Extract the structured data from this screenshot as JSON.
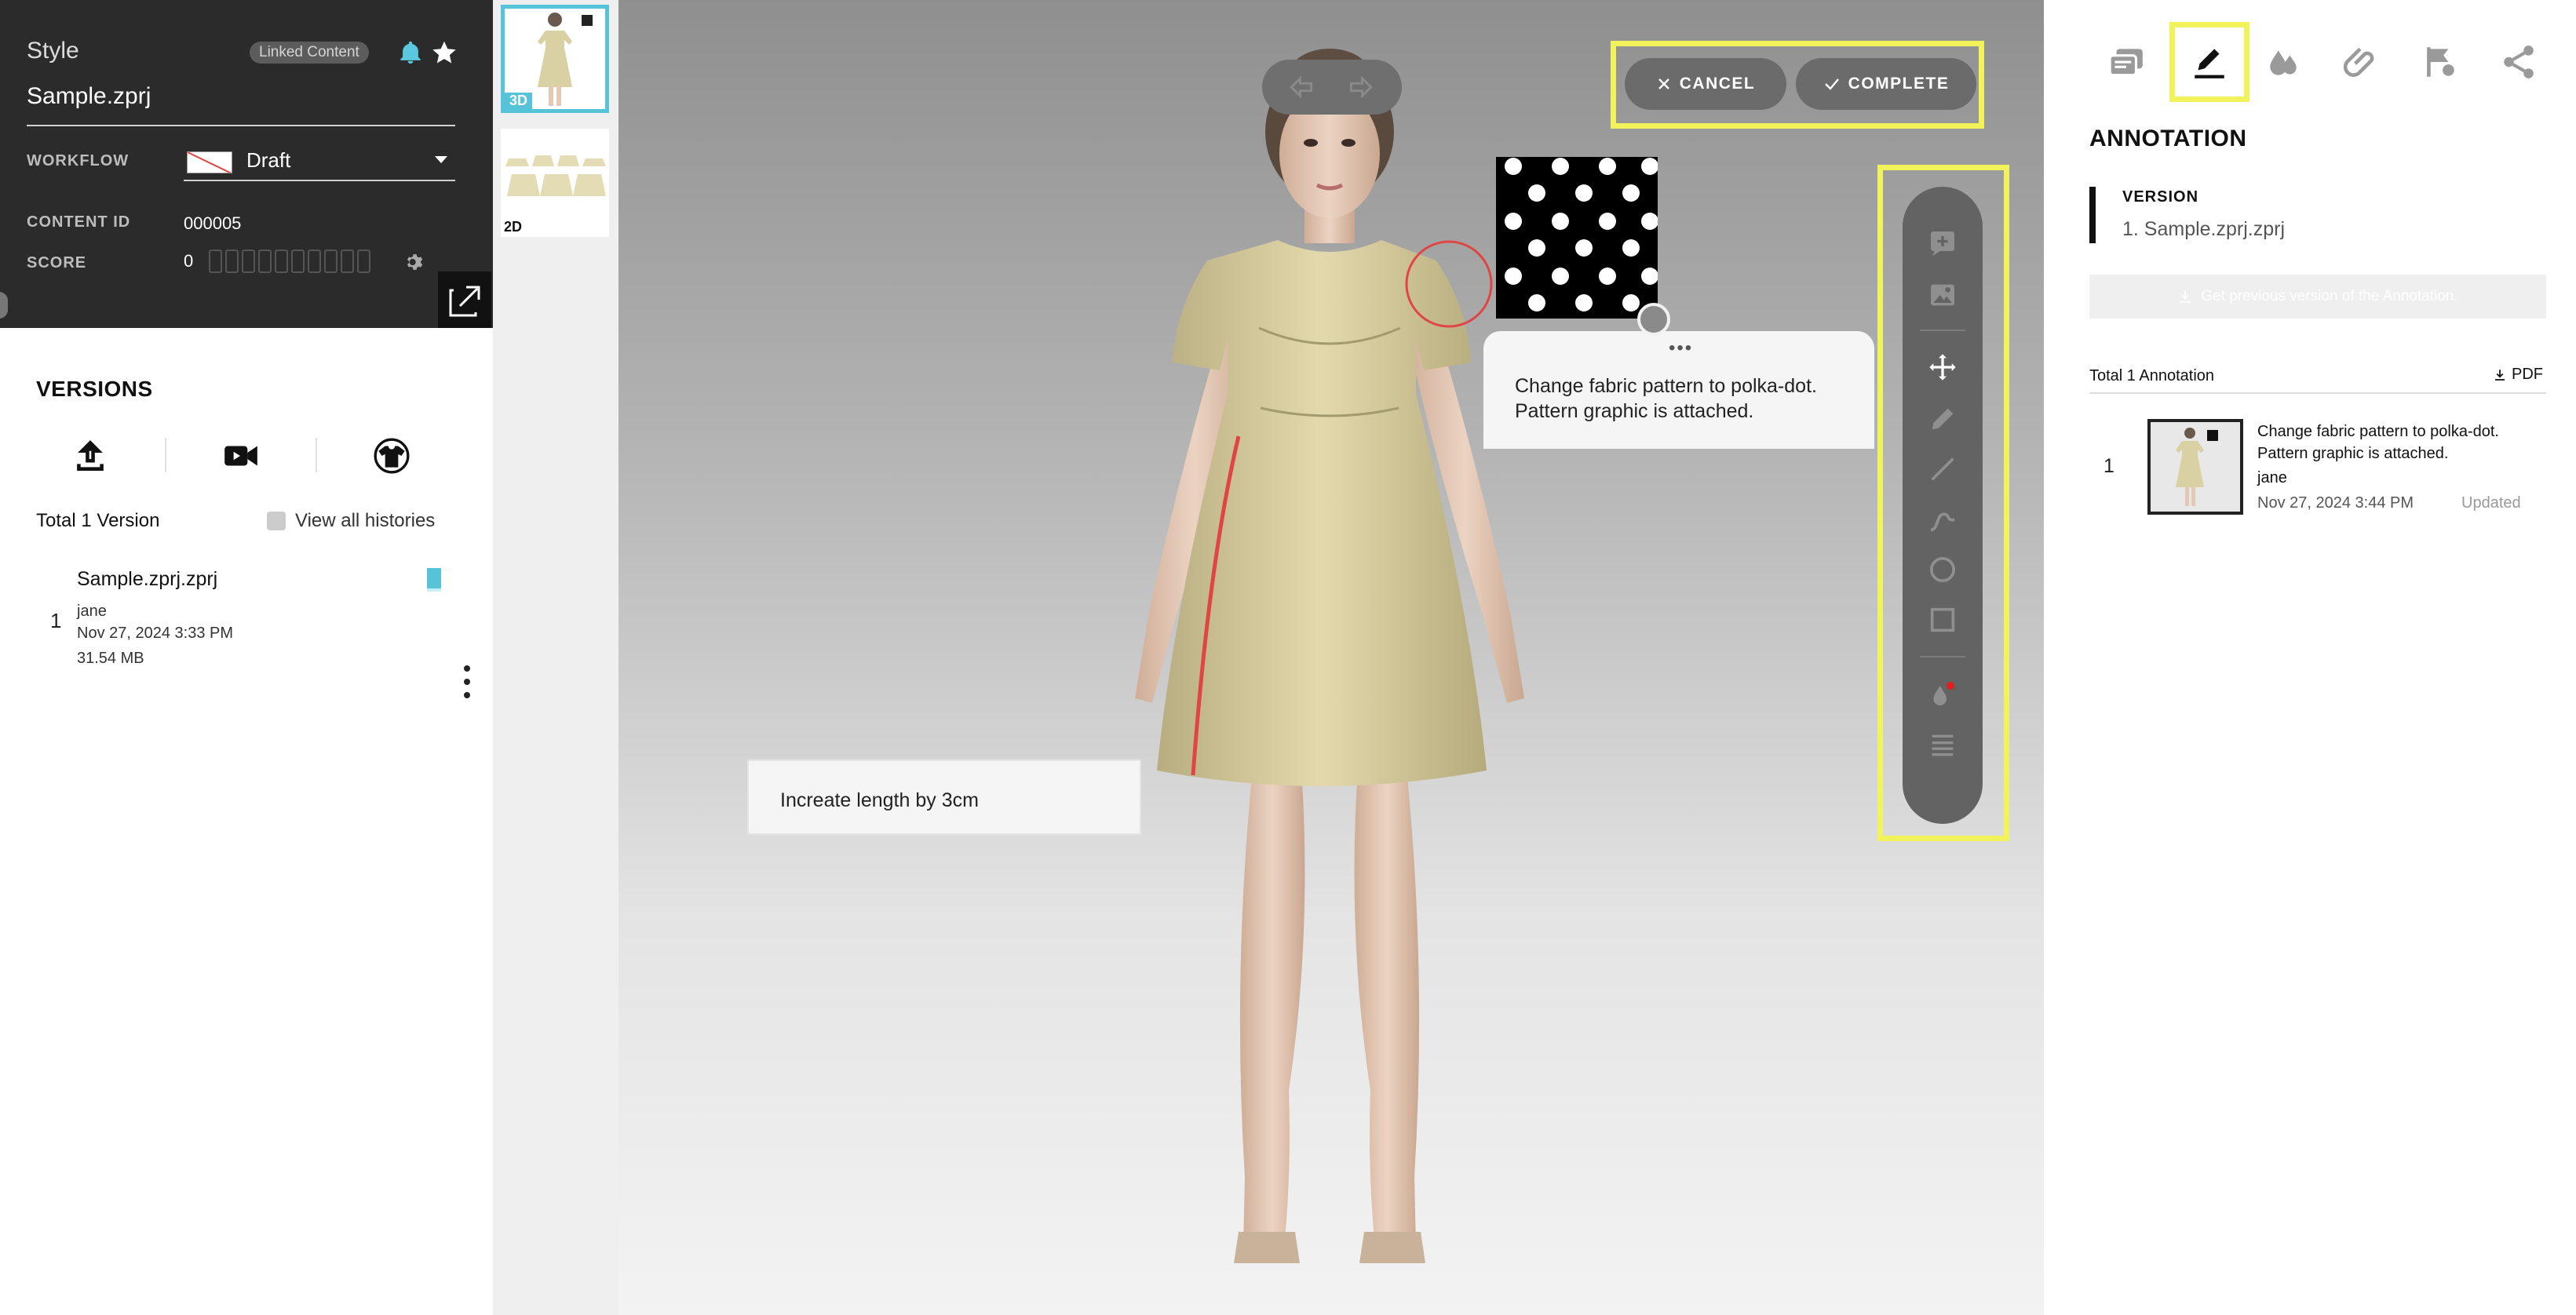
{
  "style_panel": {
    "section_label": "Style",
    "linked_badge": "Linked Content",
    "file_name": "Sample.zprj",
    "workflow_label": "WORKFLOW",
    "workflow_value": "Draft",
    "content_id_label": "CONTENT ID",
    "content_id_value": "000005",
    "score_label": "SCORE",
    "score_value": "0"
  },
  "versions": {
    "title": "VERSIONS",
    "total": "Total 1 Version",
    "view_all": "View all histories",
    "items": [
      {
        "number": "1",
        "file": "Sample.zprj.zprj",
        "user": "jane",
        "date": "Nov 27, 2024 3:33 PM",
        "size": "31.54 MB"
      }
    ]
  },
  "thumbnails": {
    "view_3d": "3D",
    "view_2d": "2D"
  },
  "viewport": {
    "cancel_label": "CANCEL",
    "complete_label": "COMPLETE",
    "note_length": "Increate length by 3cm",
    "note_fabric_line1": "Change fabric pattern to polka-dot.",
    "note_fabric_line2": "Pattern graphic is attached.",
    "note_menu": "•••"
  },
  "annotation_panel": {
    "title": "ANNOTATION",
    "version_label": "VERSION",
    "version_value": "1. Sample.zprj.zprj",
    "prev_button": "Get previous version of the Annotation.",
    "total": "Total 1 Annotation",
    "pdf_label": "PDF",
    "items": [
      {
        "number": "1",
        "text": "Change fabric pattern to polka-dot. Pattern graphic is attached.",
        "user": "jane",
        "date": "Nov 27, 2024 3:44 PM",
        "status": "Updated"
      }
    ]
  },
  "colors": {
    "accent": "#57c3d8",
    "highlight": "#f2f25a",
    "annotation_red": "#e04545",
    "toolbar": "#636363",
    "header_dark": "#2b2b2b"
  },
  "icons": {
    "right_tabs": [
      "comments-icon",
      "annotation-pen-icon",
      "colorway-drops-icon",
      "attachment-icon",
      "flag-icon",
      "share-icon"
    ],
    "tools": [
      "add-note-icon",
      "add-image-icon",
      "move-icon",
      "pen-icon",
      "line-icon",
      "curve-icon",
      "circle-icon",
      "rectangle-icon",
      "color-icon",
      "stroke-width-icon"
    ]
  }
}
